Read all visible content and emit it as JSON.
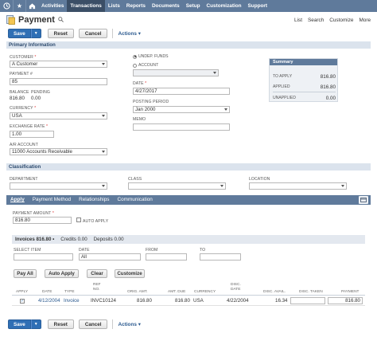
{
  "nav": {
    "items": [
      "Activities",
      "Transactions",
      "Lists",
      "Reports",
      "Documents",
      "Setup",
      "Customization",
      "Support"
    ],
    "active": "Transactions"
  },
  "page": {
    "title": "Payment",
    "links": {
      "list": "List",
      "search": "Search",
      "customize": "Customize",
      "more": "More"
    }
  },
  "toolbar": {
    "save": "Save",
    "reset": "Reset",
    "cancel": "Cancel",
    "actions": "Actions"
  },
  "primary": {
    "section": "Primary Information",
    "customer_label": "CUSTOMER",
    "customer_value": "A Customer",
    "payment_no_label": "PAYMENT #",
    "payment_no_value": "85",
    "balance_label": "BALANCE",
    "balance_value": "816.80",
    "pending_label": "PENDING",
    "pending_value": "0.00",
    "currency_label": "CURRENCY",
    "currency_value": "USA",
    "exchange_label": "EXCHANGE RATE",
    "exchange_value": "1.00",
    "ar_label": "A/R ACCOUNT",
    "ar_value": "11000 Accounts Receivable",
    "undep_label": "UNDEP. FUNDS",
    "account_label": "ACCOUNT",
    "date_label": "DATE",
    "date_value": "4/27/2017",
    "period_label": "POSTING PERIOD",
    "period_value": "Jan 2000",
    "memo_label": "MEMO"
  },
  "summary": {
    "title": "Summary",
    "to_apply_label": "TO APPLY",
    "to_apply_value": "816.80",
    "applied_label": "APPLIED",
    "applied_value": "816.80",
    "unapplied_label": "UNAPPLIED",
    "unapplied_value": "0.00"
  },
  "classification": {
    "section": "Classification",
    "department_label": "DEPARTMENT",
    "class_label": "CLASS",
    "location_label": "LOCATION"
  },
  "subtabs": [
    "Apply",
    "Payment Method",
    "Relationships",
    "Communication"
  ],
  "apply": {
    "amount_label": "PAYMENT AMOUNT",
    "amount_value": "816.80",
    "auto_apply_label": "AUTO APPLY",
    "invoices_tab": "Invoices 816.80",
    "credits_tab": "Credits 0.00",
    "deposits_tab": "Deposits 0.00",
    "select_item_label": "SELECT ITEM",
    "date_label": "DATE",
    "date_value": "All",
    "from_label": "FROM",
    "to_label": "TO",
    "buttons": {
      "pay_all": "Pay All",
      "auto_apply": "Auto Apply",
      "clear": "Clear",
      "customize": "Customize"
    }
  },
  "table": {
    "headers": {
      "apply": "APPLY",
      "date": "DATE",
      "type": "TYPE",
      "ref_no": "REF NO.",
      "orig_amt": "ORIG. AMT.",
      "amt_due": "AMT. DUE",
      "currency": "CURRENCY",
      "disc_date": "DISC. DATE",
      "disc_avail": "DISC. AVAIL.",
      "disc_taken": "DISC. TAKEN",
      "payment": "PAYMENT"
    },
    "rows": [
      {
        "date": "4/12/2004",
        "type": "Invoice",
        "ref_no": "INVC10124",
        "orig_amt": "816.80",
        "amt_due": "816.80",
        "currency": "USA",
        "disc_date": "4/22/2004",
        "disc_avail": "16.34",
        "disc_taken": "",
        "payment": "816.80"
      }
    ]
  }
}
